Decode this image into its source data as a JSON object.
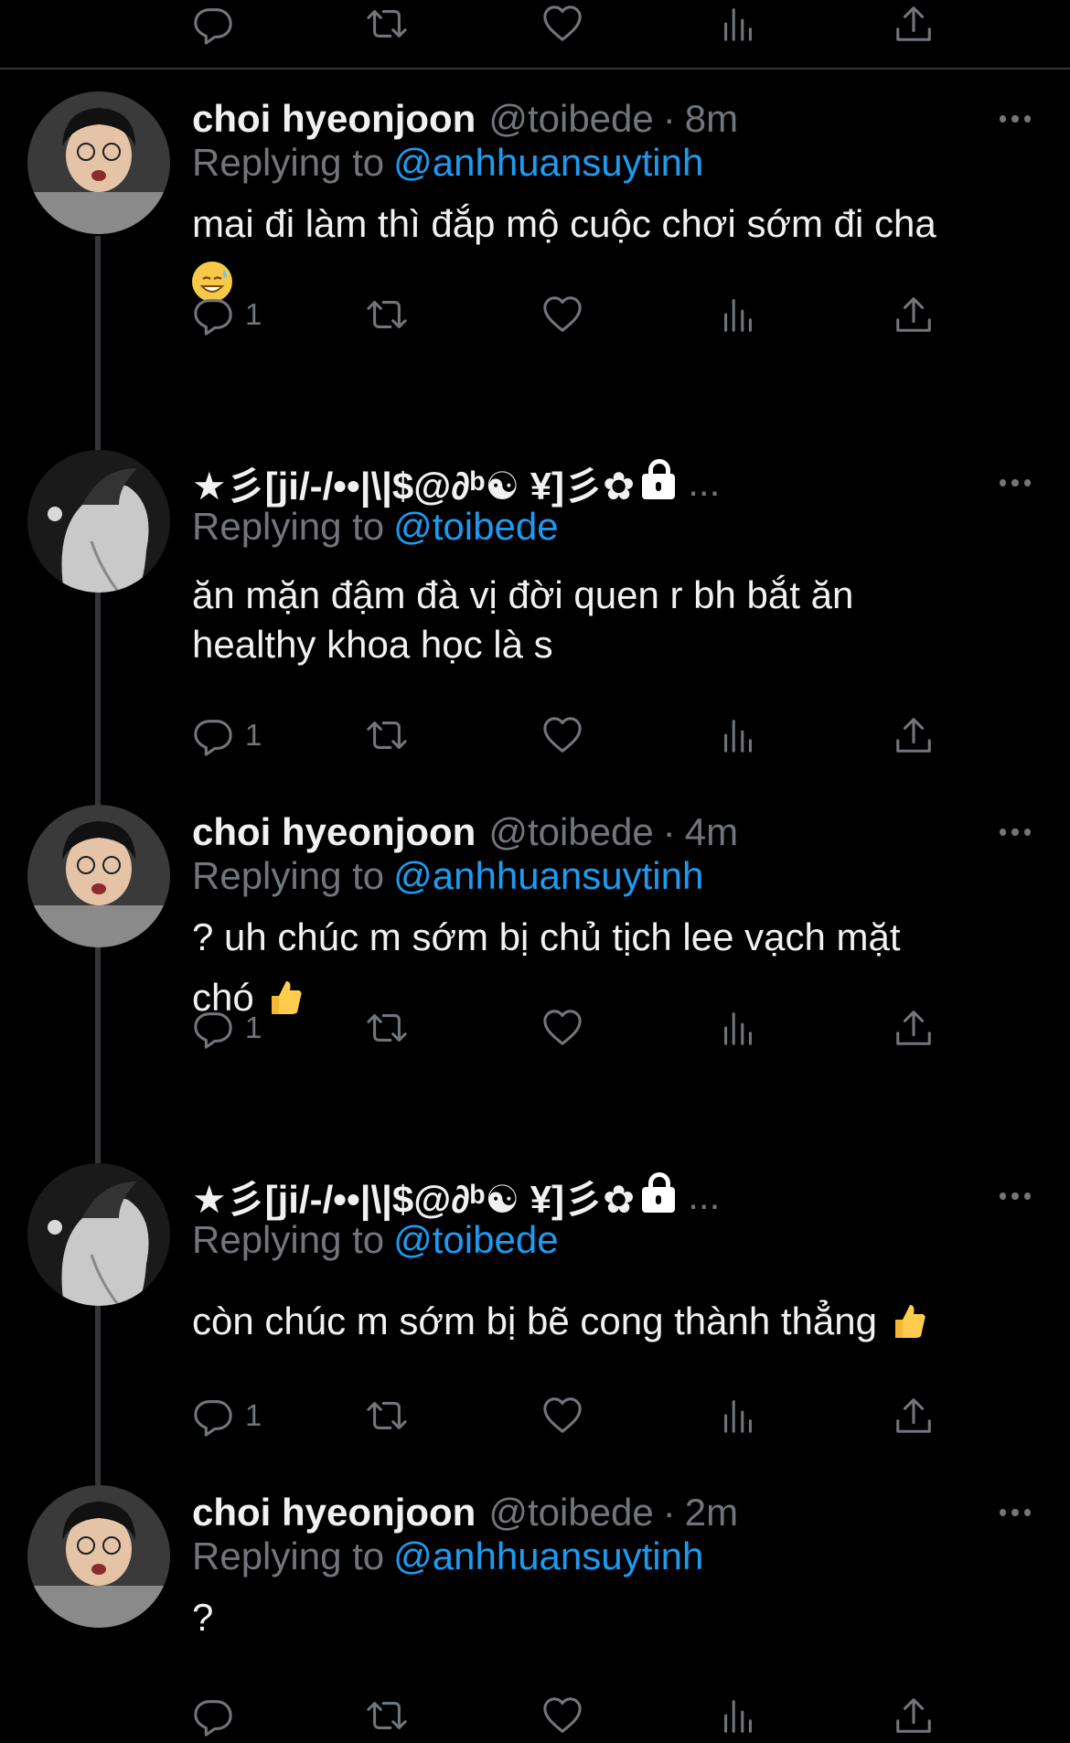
{
  "top_actions": {
    "reply_count": "",
    "icons": [
      "reply-icon",
      "retweet-icon",
      "like-icon",
      "views-icon",
      "share-icon"
    ]
  },
  "tweets": [
    {
      "name": "choi hyeonjoon",
      "handle": "@toibede",
      "time": "8m",
      "replying_label": "Replying to",
      "replying_to": "@anhhuansuytinh",
      "text": "mai đi làm thì đắp mộ cuộc chơi sớm đi cha",
      "emoji": "grinning-sweat-emoji",
      "reply_count": "1"
    },
    {
      "name": "★彡[ji/-/••|\\|$@∂ᵇ☯ ¥]彡✿",
      "name_suffix": "...",
      "handle": "",
      "time": "",
      "replying_label": "Replying to",
      "replying_to": "@toibede",
      "text_line1": "ăn mặn đậm đà vị đời quen r bh bắt ăn",
      "text_line2": "healthy khoa học là s",
      "reply_count": "1"
    },
    {
      "name": "choi hyeonjoon",
      "handle": "@toibede",
      "time": "4m",
      "replying_label": "Replying to",
      "replying_to": "@anhhuansuytinh",
      "text_line1": "? uh chúc m sớm bị chủ tịch lee vạch mặt",
      "text_line2": "chó",
      "emoji": "thumbs-up-emoji",
      "reply_count": "1"
    },
    {
      "name": "★彡[ji/-/••|\\|$@∂ᵇ☯ ¥]彡✿",
      "name_suffix": "...",
      "replying_label": "Replying to",
      "replying_to": "@toibede",
      "text": "còn chúc m sớm bị bẽ cong thành thẳng",
      "emoji": "thumbs-up-emoji",
      "reply_count": "1"
    },
    {
      "name": "choi hyeonjoon",
      "handle": "@toibede",
      "time": "2m",
      "replying_label": "Replying to",
      "replying_to": "@anhhuansuytinh",
      "text": "?"
    }
  ],
  "colors": {
    "background": "#000000",
    "text": "#e7e9ea",
    "muted": "#71767b",
    "link": "#1d9bf0",
    "divider": "#2f3336"
  }
}
